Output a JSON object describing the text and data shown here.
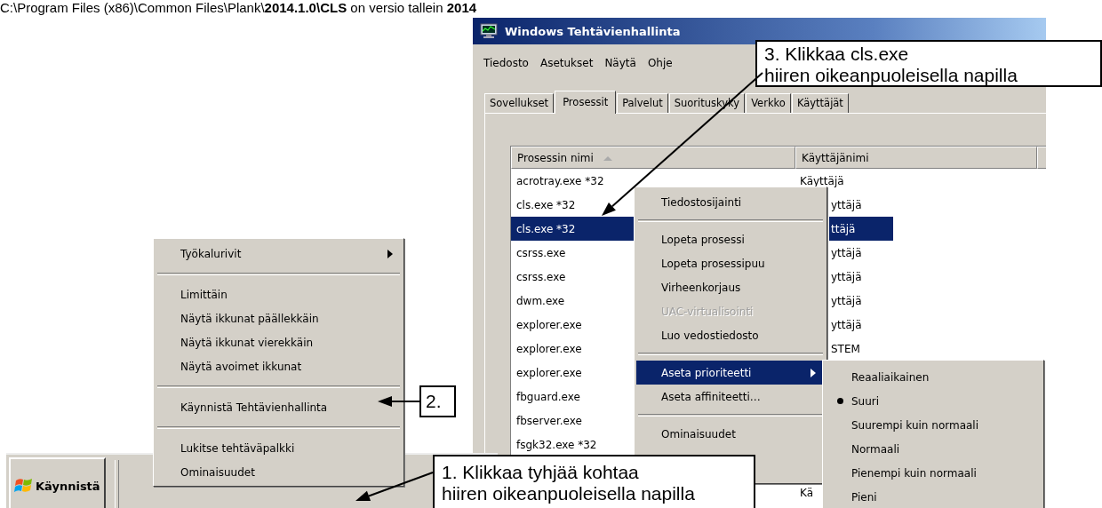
{
  "caption": "C:\\Program Files (x86)\\Common Files\\Plank\\**2014.1.0\\CLS** on versio tallein **2014**",
  "window": {
    "title": "Windows Tehtävienhallinta",
    "menu": [
      "Tiedosto",
      "Asetukset",
      "Näytä",
      "Ohje"
    ],
    "tabs": [
      {
        "label": "Sovellukset",
        "selected": false
      },
      {
        "label": "Prosessit",
        "selected": true
      },
      {
        "label": "Palvelut",
        "selected": false
      },
      {
        "label": "Suorituskyky",
        "selected": false
      },
      {
        "label": "Verkko",
        "selected": false
      },
      {
        "label": "Käyttäjät",
        "selected": false
      }
    ],
    "table": {
      "columns": [
        "Prosessin nimi",
        "Käyttäjänimi"
      ],
      "rows": [
        {
          "name": "acrotray.exe *32",
          "user": "Käyttäjä",
          "selected": false
        },
        {
          "name": "cls.exe *32",
          "user": "yttäjä",
          "selected": false
        },
        {
          "name": "cls.exe *32",
          "user": "ttäjä",
          "selected": true
        },
        {
          "name": "csrss.exe",
          "user": "yttäjä",
          "selected": false
        },
        {
          "name": "csrss.exe",
          "user": "yttäjä",
          "selected": false
        },
        {
          "name": "dwm.exe",
          "user": "yttäjä",
          "selected": false
        },
        {
          "name": "explorer.exe",
          "user": "yttäjä",
          "selected": false
        },
        {
          "name": "explorer.exe",
          "user": "STEM",
          "selected": false
        },
        {
          "name": "explorer.exe",
          "selected": false
        },
        {
          "name": "fbguard.exe",
          "selected": false
        },
        {
          "name": "fbserver.exe",
          "selected": false
        },
        {
          "name": "fsgk32.exe *32",
          "selected": false
        },
        {
          "user": "Kä",
          "selected": false
        }
      ]
    }
  },
  "context_menu": [
    {
      "kind": "item",
      "label": "Tiedostosijainti",
      "disabled": false,
      "highlighted": false,
      "submenu": false
    },
    {
      "kind": "separator"
    },
    {
      "kind": "item",
      "label": "Lopeta prosessi",
      "disabled": false,
      "highlighted": false,
      "submenu": false
    },
    {
      "kind": "item",
      "label": "Lopeta prosessipuu",
      "disabled": false,
      "highlighted": false,
      "submenu": false
    },
    {
      "kind": "item",
      "label": "Virheenkorjaus",
      "disabled": false,
      "highlighted": false,
      "submenu": false
    },
    {
      "kind": "item",
      "label": "UAC-virtualisointi",
      "disabled": true,
      "highlighted": false,
      "submenu": false
    },
    {
      "kind": "item",
      "label": "Luo vedostiedosto",
      "disabled": false,
      "highlighted": false,
      "submenu": false
    },
    {
      "kind": "separator"
    },
    {
      "kind": "item",
      "label": "Aseta prioriteetti",
      "disabled": false,
      "highlighted": true,
      "submenu": true
    },
    {
      "kind": "item",
      "label": "Aseta affiniteetti…",
      "disabled": false,
      "highlighted": false,
      "submenu": false
    },
    {
      "kind": "separator"
    },
    {
      "kind": "item",
      "label": "Ominaisuudet",
      "disabled": false,
      "highlighted": false,
      "submenu": false
    }
  ],
  "priority_menu": [
    {
      "label": "Reaaliaikainen",
      "selected": false
    },
    {
      "label": "Suuri",
      "selected": true
    },
    {
      "label": "Suurempi kuin normaali",
      "selected": false
    },
    {
      "label": "Normaali",
      "selected": false
    },
    {
      "label": "Pienempi kuin normaali",
      "selected": false
    },
    {
      "label": "Pieni",
      "selected": false
    }
  ],
  "taskbar": {
    "start_button": "Käynnistä"
  },
  "taskbar_menu": [
    {
      "kind": "item",
      "label": "Työkalurivit",
      "submenu": true
    },
    {
      "kind": "separator"
    },
    {
      "kind": "item",
      "label": "Limittäin",
      "submenu": false
    },
    {
      "kind": "item",
      "label": "Näytä ikkunat päällekkäin",
      "submenu": false
    },
    {
      "kind": "item",
      "label": "Näytä ikkunat vierekkäin",
      "submenu": false
    },
    {
      "kind": "item",
      "label": "Näytä avoimet ikkunat",
      "submenu": false
    },
    {
      "kind": "separator"
    },
    {
      "kind": "item",
      "label": "Käynnistä Tehtävienhallinta",
      "submenu": false
    },
    {
      "kind": "separator"
    },
    {
      "kind": "item",
      "label": "Lukitse tehtäväpalkki",
      "submenu": false
    },
    {
      "kind": "item",
      "label": "Ominaisuudet",
      "submenu": false
    }
  ],
  "callouts": [
    {
      "lines": [
        "3. Klikkaa cls.exe",
        "hiiren oikeanpuoleisella napilla"
      ]
    },
    {
      "lines": [
        "2."
      ]
    },
    {
      "lines": [
        "1. Klikkaa tyhjää kohtaa",
        "hiiren oikeanpuoleisella napilla"
      ]
    }
  ]
}
